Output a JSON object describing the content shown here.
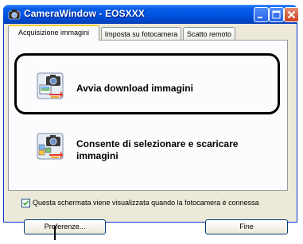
{
  "window": {
    "title": "CameraWindow - EOSXXX",
    "controls": {
      "minimize_icon": "minimize-icon",
      "maximize_icon": "maximize-icon",
      "close_icon": "close-icon"
    }
  },
  "tabs": [
    {
      "label": "Acquisizione immagini",
      "active": true
    },
    {
      "label": "Imposta su fotocamera",
      "active": false
    },
    {
      "label": "Scatto remoto",
      "active": false
    }
  ],
  "actions": [
    {
      "label_lines": [
        "Avvia download immagini"
      ],
      "icon": "camera-download-icon",
      "highlighted": true
    },
    {
      "label_lines": [
        "Consente di selezionare e scaricare",
        "immagini"
      ],
      "icon": "camera-select-download-icon",
      "highlighted": false
    }
  ],
  "options": {
    "show_on_connect": {
      "checked": true,
      "label": "Questa schermata viene visualizzata quando la fotocamera è connessa"
    }
  },
  "buttons": {
    "preferences": "Preferenze...",
    "finish": "Fine"
  },
  "colors": {
    "titlebar": "#0054e3",
    "window_bg": "#ece9d8",
    "highlight_ring": "#000000",
    "active_tab_accent": "#ffc83c"
  }
}
